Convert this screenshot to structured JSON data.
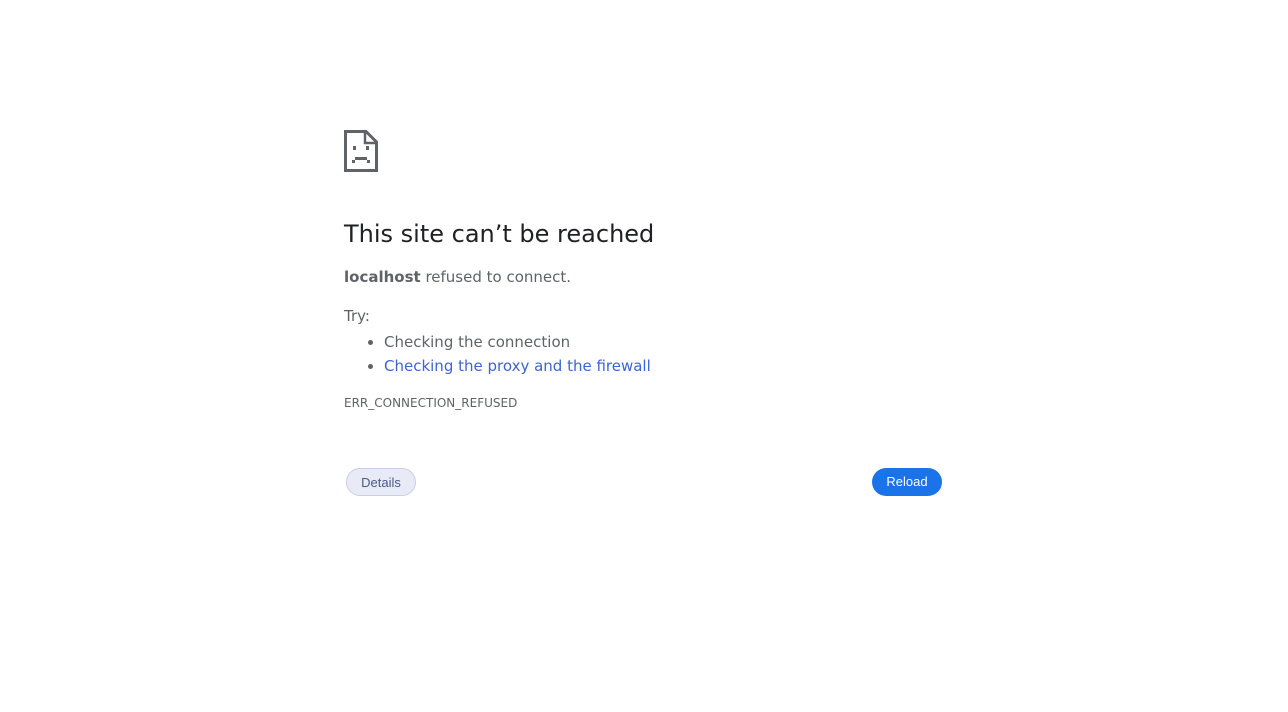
{
  "error": {
    "icon": "sad-page-icon",
    "title": "This site can’t be reached",
    "host": "localhost",
    "summary_suffix": " refused to connect.",
    "try_label": "Try:",
    "suggestions": [
      "Checking the connection",
      "Checking the proxy and the firewall"
    ],
    "code": "ERR_CONNECTION_REFUSED"
  },
  "buttons": {
    "details": "Details",
    "reload": "Reload"
  },
  "colors": {
    "link": "#3c64d8",
    "reload_bg": "#1a73e8",
    "text": "#5f6368",
    "heading": "#202124"
  }
}
